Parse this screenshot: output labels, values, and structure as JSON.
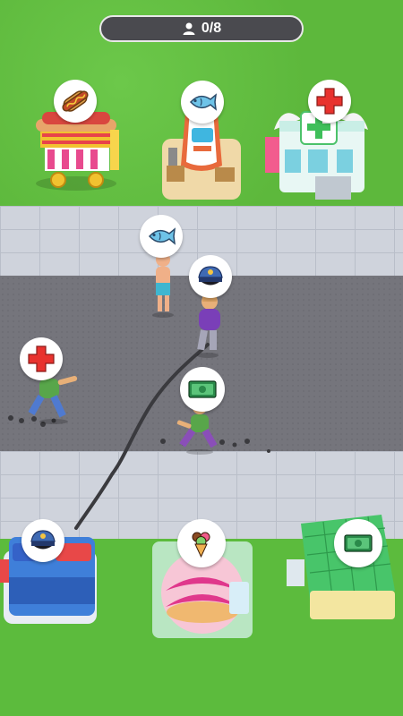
{
  "hud": {
    "player_count": "0/8",
    "player_icon": "person-icon"
  },
  "buildings": [
    {
      "name": "hotdog-cart",
      "icon": "hotdog-icon"
    },
    {
      "name": "fish-boat-shop",
      "icon": "fish-icon"
    },
    {
      "name": "hospital",
      "icon": "red-cross-icon"
    },
    {
      "name": "police-station",
      "icon": "police-cap-icon"
    },
    {
      "name": "ice-cream-shop",
      "icon": "ice-cream-icon"
    },
    {
      "name": "bank",
      "icon": "money-icon"
    }
  ],
  "customers": [
    {
      "name": "customer-fish",
      "want_icon": "fish-icon"
    },
    {
      "name": "customer-police",
      "want_icon": "police-cap-icon"
    },
    {
      "name": "customer-medical",
      "want_icon": "red-cross-icon"
    },
    {
      "name": "customer-money",
      "want_icon": "money-icon"
    }
  ],
  "colors": {
    "grass": "#5cbb3d",
    "road": "#75757c",
    "sidewalk": "#cfd3dc",
    "hud_bg": "#4a4a4f"
  }
}
